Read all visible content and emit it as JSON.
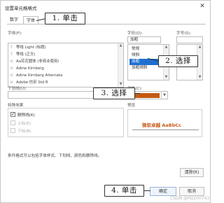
{
  "dialog": {
    "title": "设置单元格格式",
    "tabs": [
      {
        "label": "数字"
      },
      {
        "label": "字体"
      }
    ],
    "font": {
      "label": "字体(F):",
      "items": [
        {
          "icon": "tt",
          "label": "等线 Light (标题)"
        },
        {
          "icon": "tt",
          "label": "等线 (正文)"
        },
        {
          "icon": "o",
          "label": "Aa花花圆体 (非商业使用)"
        },
        {
          "icon": "o",
          "label": "Adine Kirnberg"
        },
        {
          "icon": "o",
          "label": "Adine Kirnberg Alternate"
        },
        {
          "icon": "o",
          "label": "Adobe 仿宋 Std R"
        }
      ]
    },
    "style": {
      "label": "字形(O):",
      "value": "加粗",
      "items": [
        "常规",
        "倾斜",
        "加粗",
        "加粗倾斜"
      ],
      "selected_index": 2
    },
    "size": {
      "label": "字号(S):"
    },
    "underline": {
      "label": "下划线(U):"
    },
    "color": {
      "label": "颜色(C):",
      "swatch": "#c55a11"
    },
    "effects": {
      "label": "特殊效果",
      "items": [
        {
          "label": "删除线(K)",
          "checked": true,
          "disabled": false
        },
        {
          "label": "上标(E)",
          "checked": false,
          "disabled": true
        },
        {
          "label": "下标(B)",
          "checked": false,
          "disabled": true
        }
      ]
    },
    "preview": {
      "label": "预览",
      "text": "微软卓越 AaBbCc"
    },
    "note": "条件格式可以包括字体样式、下划线、颜色和删除线。",
    "clear_button": "清除(R)",
    "ok_button": "确定",
    "cancel_button": "取消",
    "close_glyph": "✕"
  },
  "annotations": {
    "step1": "1. 单击",
    "step2": "2. 选择",
    "step3": "3. 选择",
    "step4": "4. 单击"
  },
  "watermark": "CSDN @Mz200743",
  "icons": {
    "dropdown": "chevron-down-icon",
    "close": "close-icon"
  }
}
